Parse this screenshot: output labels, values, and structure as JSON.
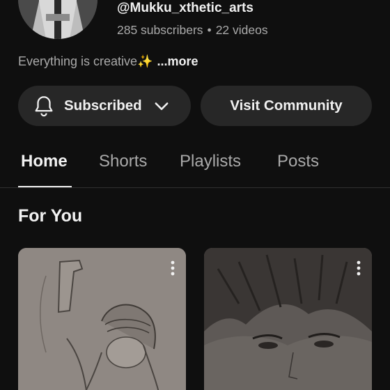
{
  "channel": {
    "handle": "@Mukku_xthetic_arts",
    "subscribers": "285 subscribers",
    "separator": "•",
    "videos": "22 videos",
    "description": "Everything is creative✨",
    "more_label": "...more"
  },
  "actions": {
    "subscribed_label": "Subscribed",
    "visit_community_label": "Visit Community"
  },
  "tabs": [
    {
      "label": "Home",
      "active": true
    },
    {
      "label": "Shorts",
      "active": false
    },
    {
      "label": "Playlists",
      "active": false
    },
    {
      "label": "Posts",
      "active": false
    }
  ],
  "section": {
    "title": "For You"
  },
  "icons": {
    "subscribe": "bell-icon",
    "dropdown": "chevron-down-icon",
    "menu": "more-vert-icon"
  },
  "colors": {
    "background": "#0f0f0f",
    "button_bg": "#272727",
    "text_primary": "#f1f1f1",
    "text_secondary": "#aaaaaa"
  }
}
